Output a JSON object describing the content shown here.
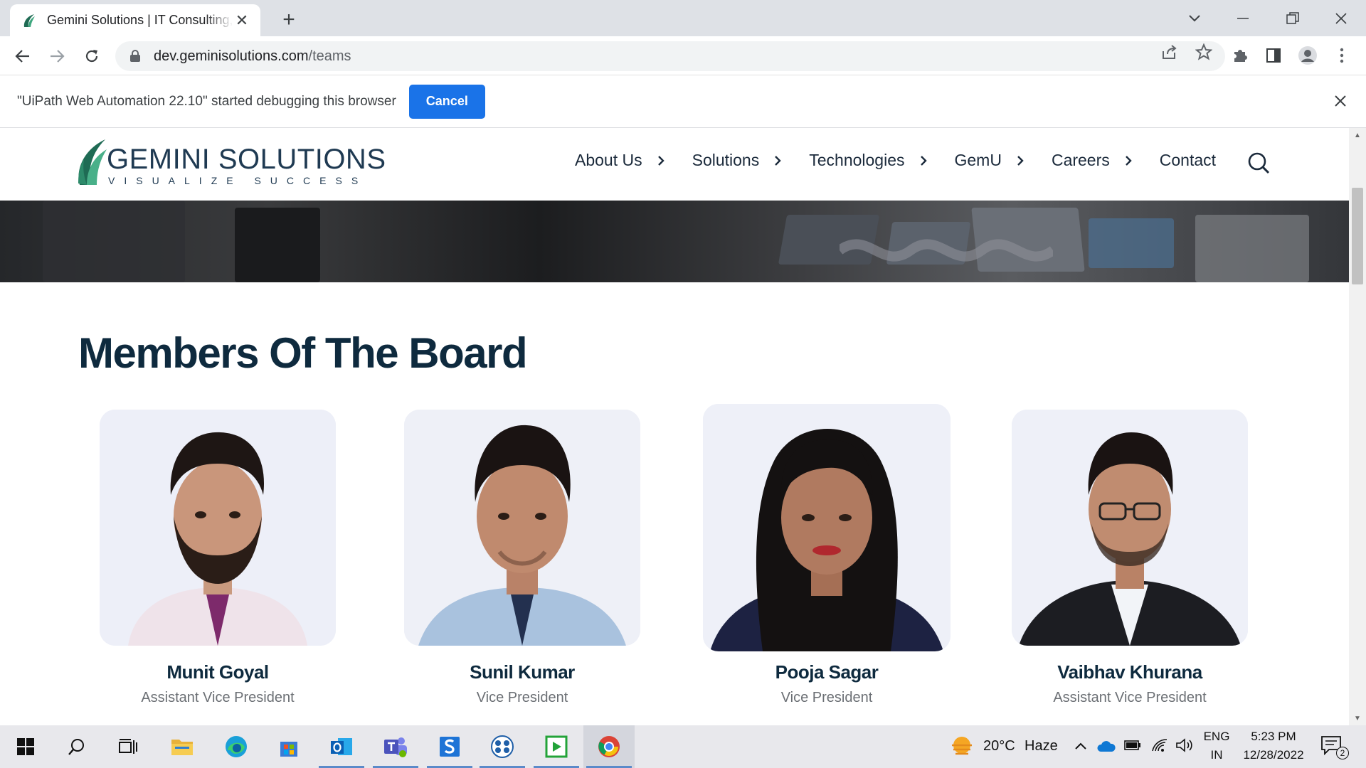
{
  "browser": {
    "tab_title": "Gemini Solutions | IT Consulting, Software Development",
    "url_host": "dev.geminisolutions.com",
    "url_path": "/teams",
    "debug_message": "\"UiPath Web Automation 22.10\" started debugging this browser",
    "debug_cancel_label": "Cancel"
  },
  "site": {
    "logo_name": "GEMINI SOLUTIONS",
    "logo_tagline": "VISUALIZE SUCCESS",
    "menu": [
      {
        "label": "About Us"
      },
      {
        "label": "Solutions"
      },
      {
        "label": "Technologies"
      },
      {
        "label": "GemU"
      },
      {
        "label": "Careers"
      },
      {
        "label": "Contact"
      }
    ]
  },
  "board": {
    "title": "Members Of The Board",
    "members": [
      {
        "name": "Munit Goyal",
        "role": "Assistant Vice President"
      },
      {
        "name": "Sunil Kumar",
        "role": "Vice President"
      },
      {
        "name": "Pooja Sagar",
        "role": "Vice President"
      },
      {
        "name": "Vaibhav Khurana",
        "role": "Assistant Vice President"
      }
    ]
  },
  "taskbar": {
    "weather_temp": "20°C",
    "weather_desc": "Haze",
    "lang_top": "ENG",
    "lang_bottom": "IN",
    "time": "5:23 PM",
    "date": "12/28/2022",
    "notification_count": "2"
  },
  "colors": {
    "accent_blue": "#1a73e8",
    "heading_navy": "#0e2a3e"
  }
}
